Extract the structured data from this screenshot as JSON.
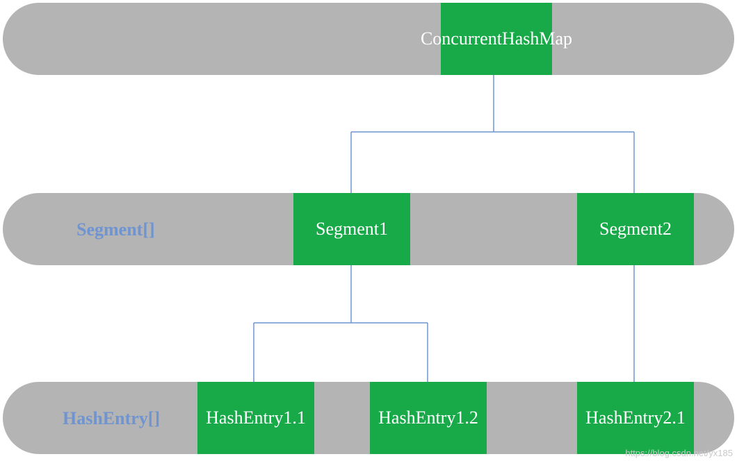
{
  "diagram": {
    "row1": {
      "concurrentHashMap": "ConcurrentHashMap"
    },
    "row2": {
      "label": "Segment[]",
      "segment1": "Segment1",
      "segment2": "Segment2"
    },
    "row3": {
      "label": "HashEntry[]",
      "entry11": "HashEntry1.1",
      "entry12": "HashEntry1.2",
      "entry21": "HashEntry2.1"
    }
  },
  "watermark": "https://blog.csdn.net/yx185"
}
